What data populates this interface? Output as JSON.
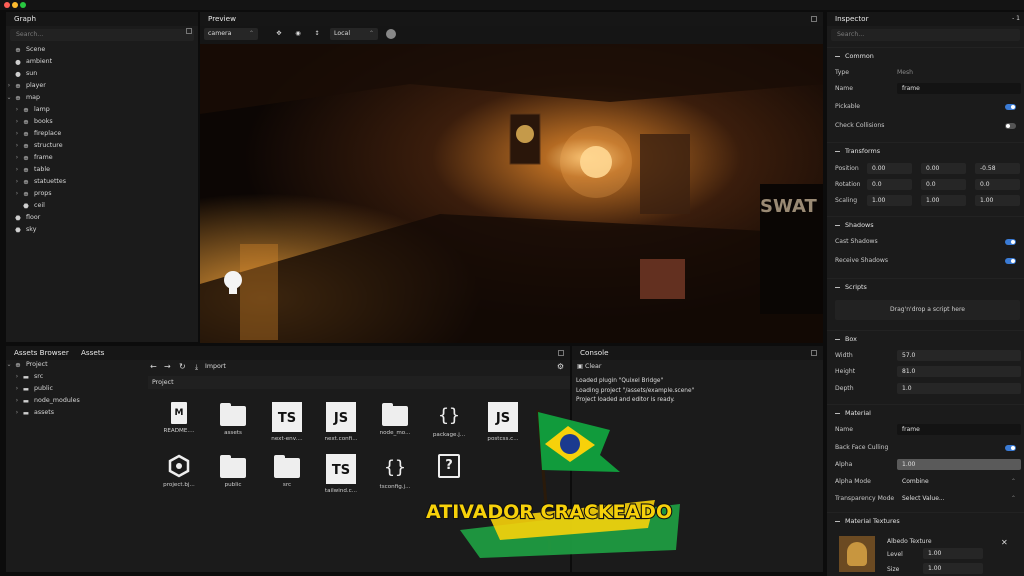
{
  "graph": {
    "title": "Graph",
    "search_placeholder": "Search...",
    "items": [
      {
        "label": "Scene",
        "icon": "scene-icon",
        "glyph": "⊕",
        "level": 0,
        "chev": ""
      },
      {
        "label": "ambient",
        "icon": "bulb-icon",
        "glyph": "●",
        "level": 0,
        "chev": ""
      },
      {
        "label": "sun",
        "icon": "bulb-icon",
        "glyph": "●",
        "level": 0,
        "chev": ""
      },
      {
        "label": "player",
        "icon": "node-icon",
        "glyph": "⊕",
        "level": 0,
        "chev": "›"
      },
      {
        "label": "map",
        "icon": "node-icon",
        "glyph": "⊕",
        "level": 0,
        "chev": "⌄"
      },
      {
        "label": "lamp",
        "icon": "node-icon",
        "glyph": "⊕",
        "level": 1,
        "chev": "›"
      },
      {
        "label": "books",
        "icon": "node-icon",
        "glyph": "⊕",
        "level": 1,
        "chev": "›"
      },
      {
        "label": "fireplace",
        "icon": "node-icon",
        "glyph": "⊕",
        "level": 1,
        "chev": "›"
      },
      {
        "label": "structure",
        "icon": "node-icon",
        "glyph": "⊕",
        "level": 1,
        "chev": "›"
      },
      {
        "label": "frame",
        "icon": "node-icon",
        "glyph": "⊕",
        "level": 1,
        "chev": "›"
      },
      {
        "label": "table",
        "icon": "node-icon",
        "glyph": "⊕",
        "level": 1,
        "chev": "›"
      },
      {
        "label": "statuettes",
        "icon": "node-icon",
        "glyph": "⊕",
        "level": 1,
        "chev": "›"
      },
      {
        "label": "props",
        "icon": "node-icon",
        "glyph": "⊕",
        "level": 1,
        "chev": "›"
      },
      {
        "label": "ceil",
        "icon": "mesh-icon",
        "glyph": "⬣",
        "level": 1,
        "chev": ""
      },
      {
        "label": "floor",
        "icon": "mesh-icon",
        "glyph": "⬣",
        "level": 0,
        "chev": ""
      },
      {
        "label": "sky",
        "icon": "mesh-icon",
        "glyph": "⬣",
        "level": 0,
        "chev": ""
      }
    ]
  },
  "preview": {
    "title": "Preview",
    "camera": "camera",
    "space": "Local"
  },
  "inspector": {
    "title": "Inspector",
    "menu": "- 1",
    "search_placeholder": "Search...",
    "common": {
      "title": "Common",
      "type_label": "Type",
      "type_value": "Mesh",
      "name_label": "Name",
      "name_value": "frame",
      "pickable_label": "Pickable",
      "pickable": true,
      "collisions_label": "Check Collisions",
      "collisions": false
    },
    "transforms": {
      "title": "Transforms",
      "position_label": "Position",
      "position": [
        "0.00",
        "0.00",
        "-0.58"
      ],
      "rotation_label": "Rotation",
      "rotation": [
        "0.0",
        "0.0",
        "0.0"
      ],
      "scaling_label": "Scaling",
      "scaling": [
        "1.00",
        "1.00",
        "1.00"
      ]
    },
    "shadows": {
      "title": "Shadows",
      "cast_label": "Cast Shadows",
      "cast": true,
      "receive_label": "Receive Shadows",
      "receive": true
    },
    "scripts": {
      "title": "Scripts",
      "drop": "Drag'n'drop a script here"
    },
    "box": {
      "title": "Box",
      "width_label": "Width",
      "width": "57.0",
      "height_label": "Height",
      "height": "81.0",
      "depth_label": "Depth",
      "depth": "1.0"
    },
    "material": {
      "title": "Material",
      "name_label": "Name",
      "name_value": "frame",
      "bfc_label": "Back Face Culling",
      "bfc": true,
      "alpha_label": "Alpha",
      "alpha": "1.00",
      "alpha_mode_label": "Alpha Mode",
      "alpha_mode": "Combine",
      "transparency_label": "Transparency Mode",
      "transparency": "Select Value..."
    },
    "textures": {
      "title": "Material Textures",
      "albedo_label": "Albedo Texture",
      "level_label": "Level",
      "level": "1.00",
      "size_label": "Size",
      "size": "1.00"
    }
  },
  "assets_browser": {
    "tab1": "Assets Browser",
    "tab2": "Assets",
    "tree": [
      {
        "label": "Project",
        "level": 0,
        "chev": "⌄",
        "glyph": "⊕"
      },
      {
        "label": "src",
        "level": 1,
        "chev": "›",
        "glyph": "▬"
      },
      {
        "label": "public",
        "level": 1,
        "chev": "›",
        "glyph": "▬"
      },
      {
        "label": "node_modules",
        "level": 1,
        "chev": "›",
        "glyph": "▬"
      },
      {
        "label": "assets",
        "level": 1,
        "chev": "›",
        "glyph": "▬"
      }
    ],
    "import_label": "Import",
    "breadcrumb": "Project",
    "files": [
      {
        "label": "README....",
        "kind": "doc",
        "badge": "M"
      },
      {
        "label": "assets",
        "kind": "folder",
        "badge": ""
      },
      {
        "label": "next-env....",
        "kind": "ts",
        "badge": "TS"
      },
      {
        "label": "next.confi...",
        "kind": "ts",
        "badge": "JS"
      },
      {
        "label": "node_mo...",
        "kind": "folder",
        "badge": ""
      },
      {
        "label": "package.j...",
        "kind": "brace",
        "badge": "{}"
      },
      {
        "label": "postcss.c...",
        "kind": "ts",
        "badge": "JS"
      },
      {
        "label": "project.bj...",
        "kind": "hex",
        "badge": ""
      },
      {
        "label": "public",
        "kind": "folder",
        "badge": ""
      },
      {
        "label": "src",
        "kind": "folder",
        "badge": ""
      },
      {
        "label": "tailwind.c...",
        "kind": "ts",
        "badge": "TS"
      },
      {
        "label": "tsconfig.j...",
        "kind": "brace",
        "badge": "{}"
      },
      {
        "label": "",
        "kind": "q",
        "badge": "?"
      }
    ]
  },
  "console": {
    "title": "Console",
    "clear_label": "Clear",
    "lines": [
      "Loaded plugin \"Quixel Bridge\"",
      "Loading project \"/assets/example.scene\"",
      "Project loaded and editor is ready."
    ]
  },
  "overlay": {
    "text": "ATIVADOR CRACKEADO"
  },
  "colors": {
    "accent": "#3a7bd5",
    "panel": "#1b1b1b"
  }
}
